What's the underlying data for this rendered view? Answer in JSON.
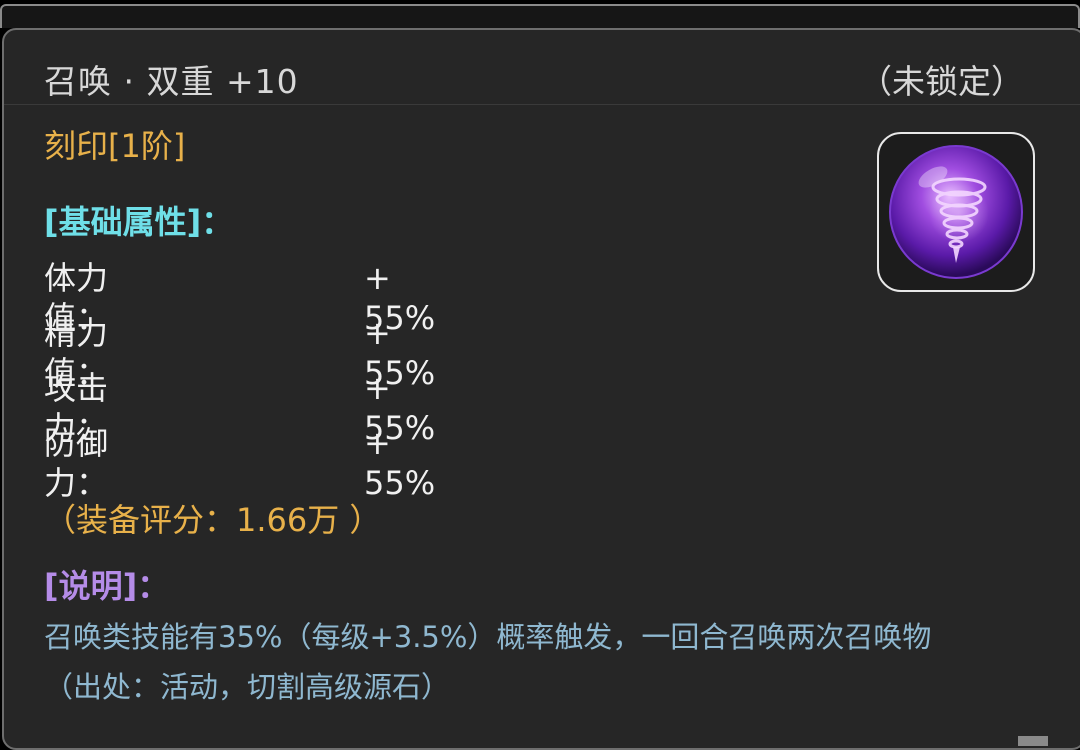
{
  "item": {
    "title": "召唤 · 双重  +10",
    "lock_status": "（未锁定）",
    "rune_tier": "刻印[1阶]",
    "icon": "purple-tornado-orb-icon"
  },
  "base_attributes": {
    "header": "[基础属性]：",
    "stats": [
      {
        "name": "体力值：",
        "value": "+ 55%"
      },
      {
        "name": "精力值：",
        "value": "+ 55%"
      },
      {
        "name": "攻击力：",
        "value": "+ 55%"
      },
      {
        "name": "防御力：",
        "value": "+ 55%"
      }
    ]
  },
  "score": "（装备评分：1.66万 ）",
  "description": {
    "header": "[说明]：",
    "lines": [
      "召唤类技能有35%（每级+3.5%）概率触发，一回合召唤两次召唤物",
      "（出处：活动，切割高级源石）"
    ]
  },
  "colors": {
    "background": "#262626",
    "tier": "#e8b14a",
    "base_header": "#6fdfe8",
    "desc_header": "#b58ce8",
    "desc_text": "#8fb8d0"
  }
}
